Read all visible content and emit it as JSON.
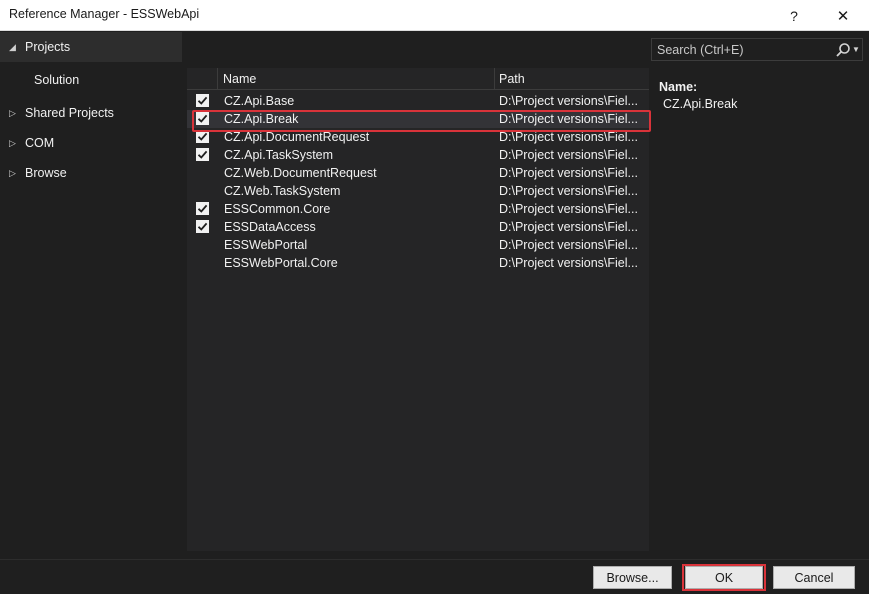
{
  "window": {
    "title": "Reference Manager - ESSWebApi",
    "help_label": "?",
    "close_label": "✕"
  },
  "nav": {
    "projects": "Projects",
    "solution": "Solution",
    "shared_projects": "Shared Projects",
    "com": "COM",
    "browse": "Browse"
  },
  "search": {
    "placeholder": "Search (Ctrl+E)",
    "value": ""
  },
  "grid": {
    "columns": [
      "Name",
      "Path"
    ],
    "rows": [
      {
        "name": "CZ.Api.Base",
        "path": "D:\\Project versions\\Fiel...",
        "checked": true
      },
      {
        "name": "CZ.Api.Break",
        "path": "D:\\Project versions\\Fiel...",
        "checked": true,
        "selected": true
      },
      {
        "name": "CZ.Api.DocumentRequest",
        "path": "D:\\Project versions\\Fiel...",
        "checked": true
      },
      {
        "name": "CZ.Api.TaskSystem",
        "path": "D:\\Project versions\\Fiel...",
        "checked": true
      },
      {
        "name": "CZ.Web.DocumentRequest",
        "path": "D:\\Project versions\\Fiel...",
        "checked": false
      },
      {
        "name": "CZ.Web.TaskSystem",
        "path": "D:\\Project versions\\Fiel...",
        "checked": false
      },
      {
        "name": "ESSCommon.Core",
        "path": "D:\\Project versions\\Fiel...",
        "checked": true
      },
      {
        "name": "ESSDataAccess",
        "path": "D:\\Project versions\\Fiel...",
        "checked": true
      },
      {
        "name": "ESSWebPortal",
        "path": "D:\\Project versions\\Fiel...",
        "checked": false
      },
      {
        "name": "ESSWebPortal.Core",
        "path": "D:\\Project versions\\Fiel...",
        "checked": false
      }
    ]
  },
  "details": {
    "name_label": "Name:",
    "name_value": "CZ.Api.Break"
  },
  "buttons": {
    "browse": "Browse...",
    "ok": "OK",
    "cancel": "Cancel"
  },
  "colors": {
    "highlight": "#d9333a",
    "background": "#1f1f1f",
    "grid": "#252526"
  }
}
